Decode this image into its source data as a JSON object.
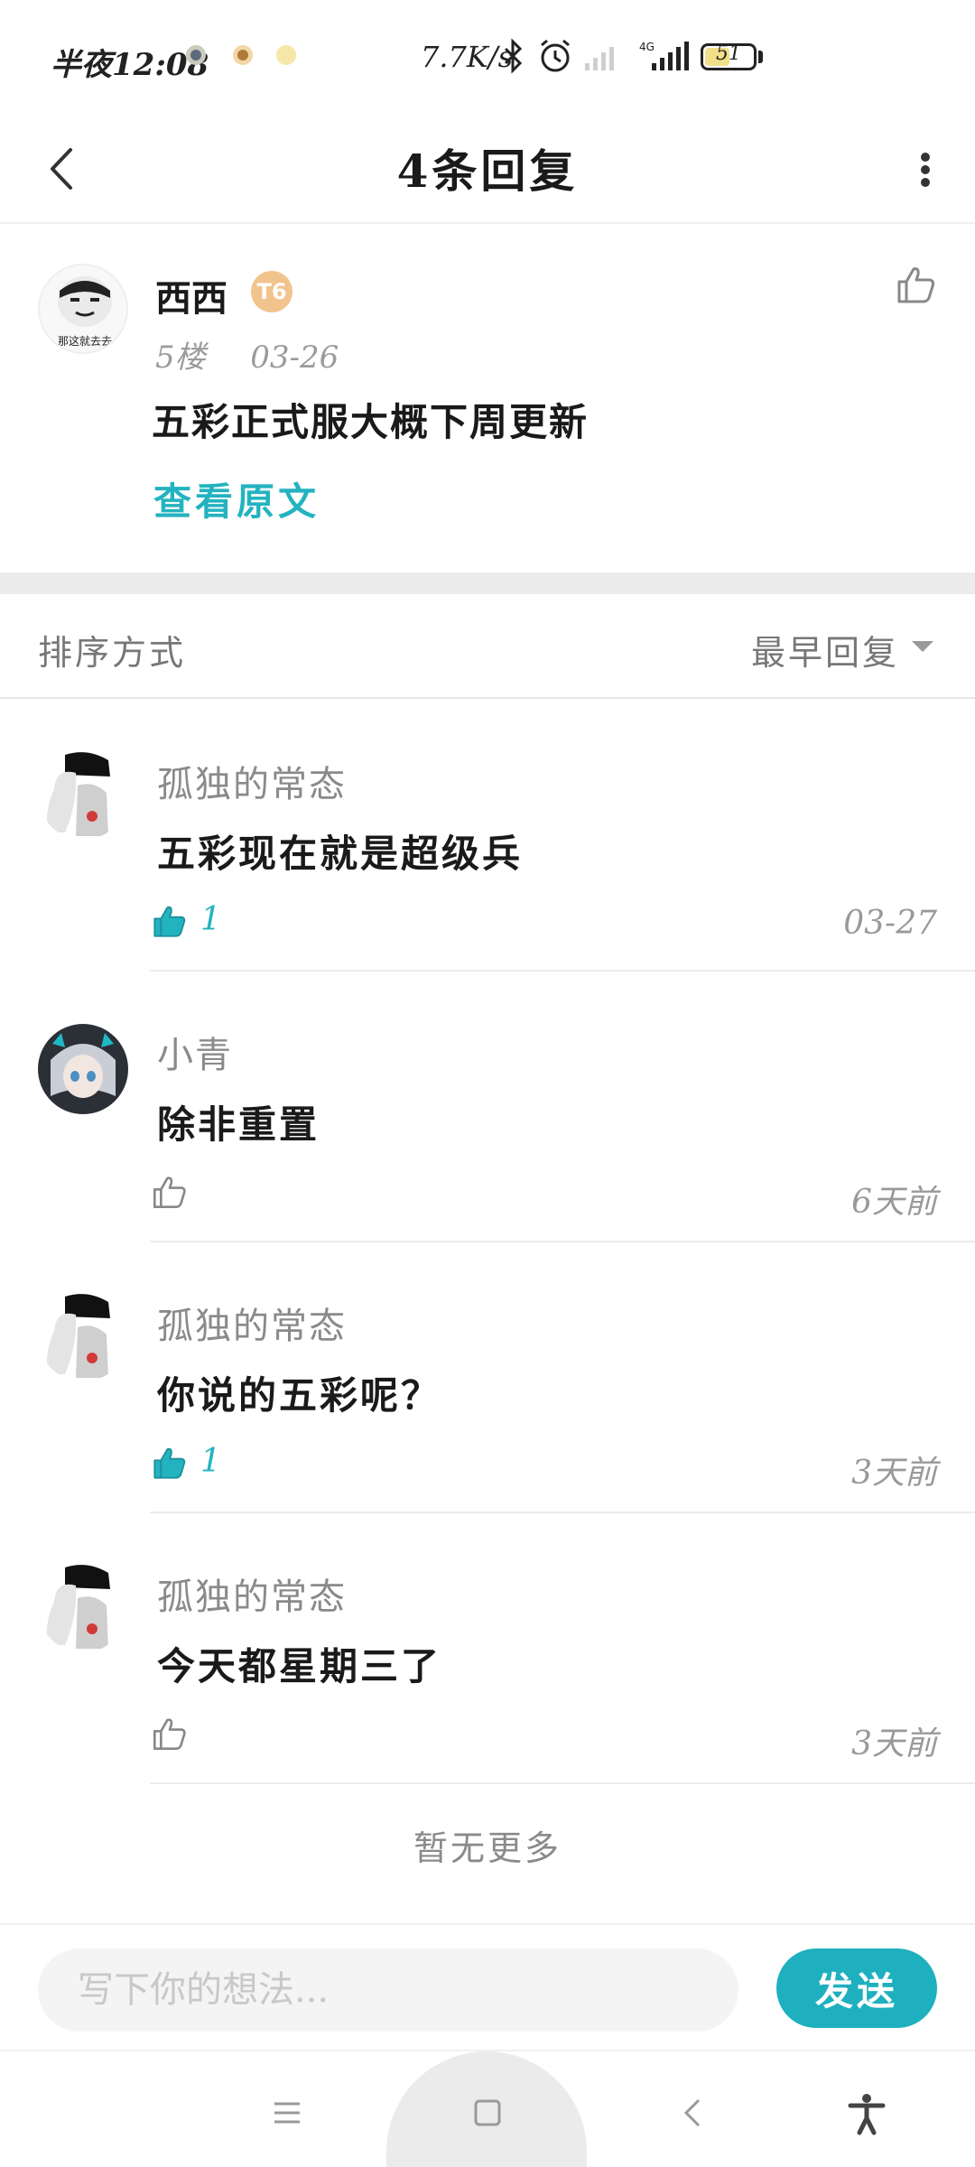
{
  "status_bar": {
    "time": "半夜12:08",
    "net_speed": "7.7K/s",
    "battery": "51",
    "battery_level": 0.51,
    "notification_icons": [
      "app-notification-icon",
      "app-notification-icon",
      "app-notification-icon"
    ],
    "icons": [
      "bluetooth-icon",
      "alarm-icon",
      "signal-icon",
      "4g-signal-icon",
      "battery-icon"
    ]
  },
  "header": {
    "title": "4条回复",
    "back_icon": "back-arrow-icon",
    "more_icon": "more-vertical-icon"
  },
  "main_comment": {
    "author": "西西",
    "level_badge": "T6",
    "floor": "5楼",
    "date": "03-26",
    "text": "五彩正式服大概下周更新",
    "view_original": "查看原文",
    "avatar_caption": "那这就去去"
  },
  "sort": {
    "label": "排序方式",
    "value": "最早回复"
  },
  "replies": [
    {
      "author": "孤独的常态",
      "text": "五彩现在就是超级兵",
      "likes": "1",
      "liked": true,
      "time": "03-27"
    },
    {
      "author": "小青",
      "text": "除非重置",
      "likes": "",
      "liked": false,
      "time": "6天前"
    },
    {
      "author": "孤独的常态",
      "text": "你说的五彩呢？",
      "likes": "1",
      "liked": true,
      "time": "3天前"
    },
    {
      "author": "孤独的常态",
      "text": "今天都星期三了",
      "likes": "",
      "liked": false,
      "time": "3天前"
    }
  ],
  "no_more": "暂无更多",
  "composer": {
    "placeholder": "写下你的想法...",
    "send_label": "发送"
  },
  "colors": {
    "accent": "#1eb0bf",
    "text_primary": "#1a1a1a",
    "text_secondary": "#999999",
    "divider": "#ececec"
  }
}
